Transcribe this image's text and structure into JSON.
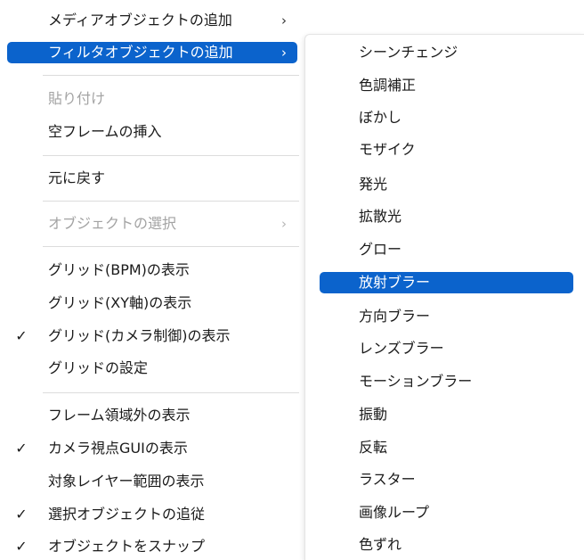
{
  "main_menu": {
    "items": [
      {
        "label": "メディアオブジェクトの追加",
        "arrow": "›"
      },
      {
        "label": "フィルタオブジェクトの追加",
        "arrow": "›"
      },
      {
        "label": "貼り付け"
      },
      {
        "label": "空フレームの挿入"
      },
      {
        "label": "元に戻す"
      },
      {
        "label": "オブジェクトの選択",
        "arrow": "›"
      },
      {
        "label": "グリッド(BPM)の表示"
      },
      {
        "label": "グリッド(XY軸)の表示"
      },
      {
        "label": "グリッド(カメラ制御)の表示",
        "check": "✓"
      },
      {
        "label": "グリッドの設定"
      },
      {
        "label": "フレーム領域外の表示"
      },
      {
        "label": "カメラ視点GUIの表示",
        "check": "✓"
      },
      {
        "label": "対象レイヤー範囲の表示"
      },
      {
        "label": "選択オブジェクトの追従",
        "check": "✓"
      },
      {
        "label": "オブジェクトをスナップ",
        "check": "✓"
      }
    ]
  },
  "sub_menu": {
    "items": [
      {
        "label": "シーンチェンジ"
      },
      {
        "label": "色調補正"
      },
      {
        "label": "ぼかし"
      },
      {
        "label": "モザイク"
      },
      {
        "label": "発光"
      },
      {
        "label": "拡散光"
      },
      {
        "label": "グロー"
      },
      {
        "label": "放射ブラー"
      },
      {
        "label": "方向ブラー"
      },
      {
        "label": "レンズブラー"
      },
      {
        "label": "モーションブラー"
      },
      {
        "label": "振動"
      },
      {
        "label": "反転"
      },
      {
        "label": "ラスター"
      },
      {
        "label": "画像ループ"
      },
      {
        "label": "色ずれ"
      }
    ]
  },
  "colors": {
    "highlight": "#0b63cc",
    "disabled_text": "#a3a3a3",
    "separator": "#dcdcdc"
  },
  "state": {
    "main_highlighted_item": "フィルタオブジェクトの追加",
    "sub_highlighted_item": "放射ブラー"
  }
}
